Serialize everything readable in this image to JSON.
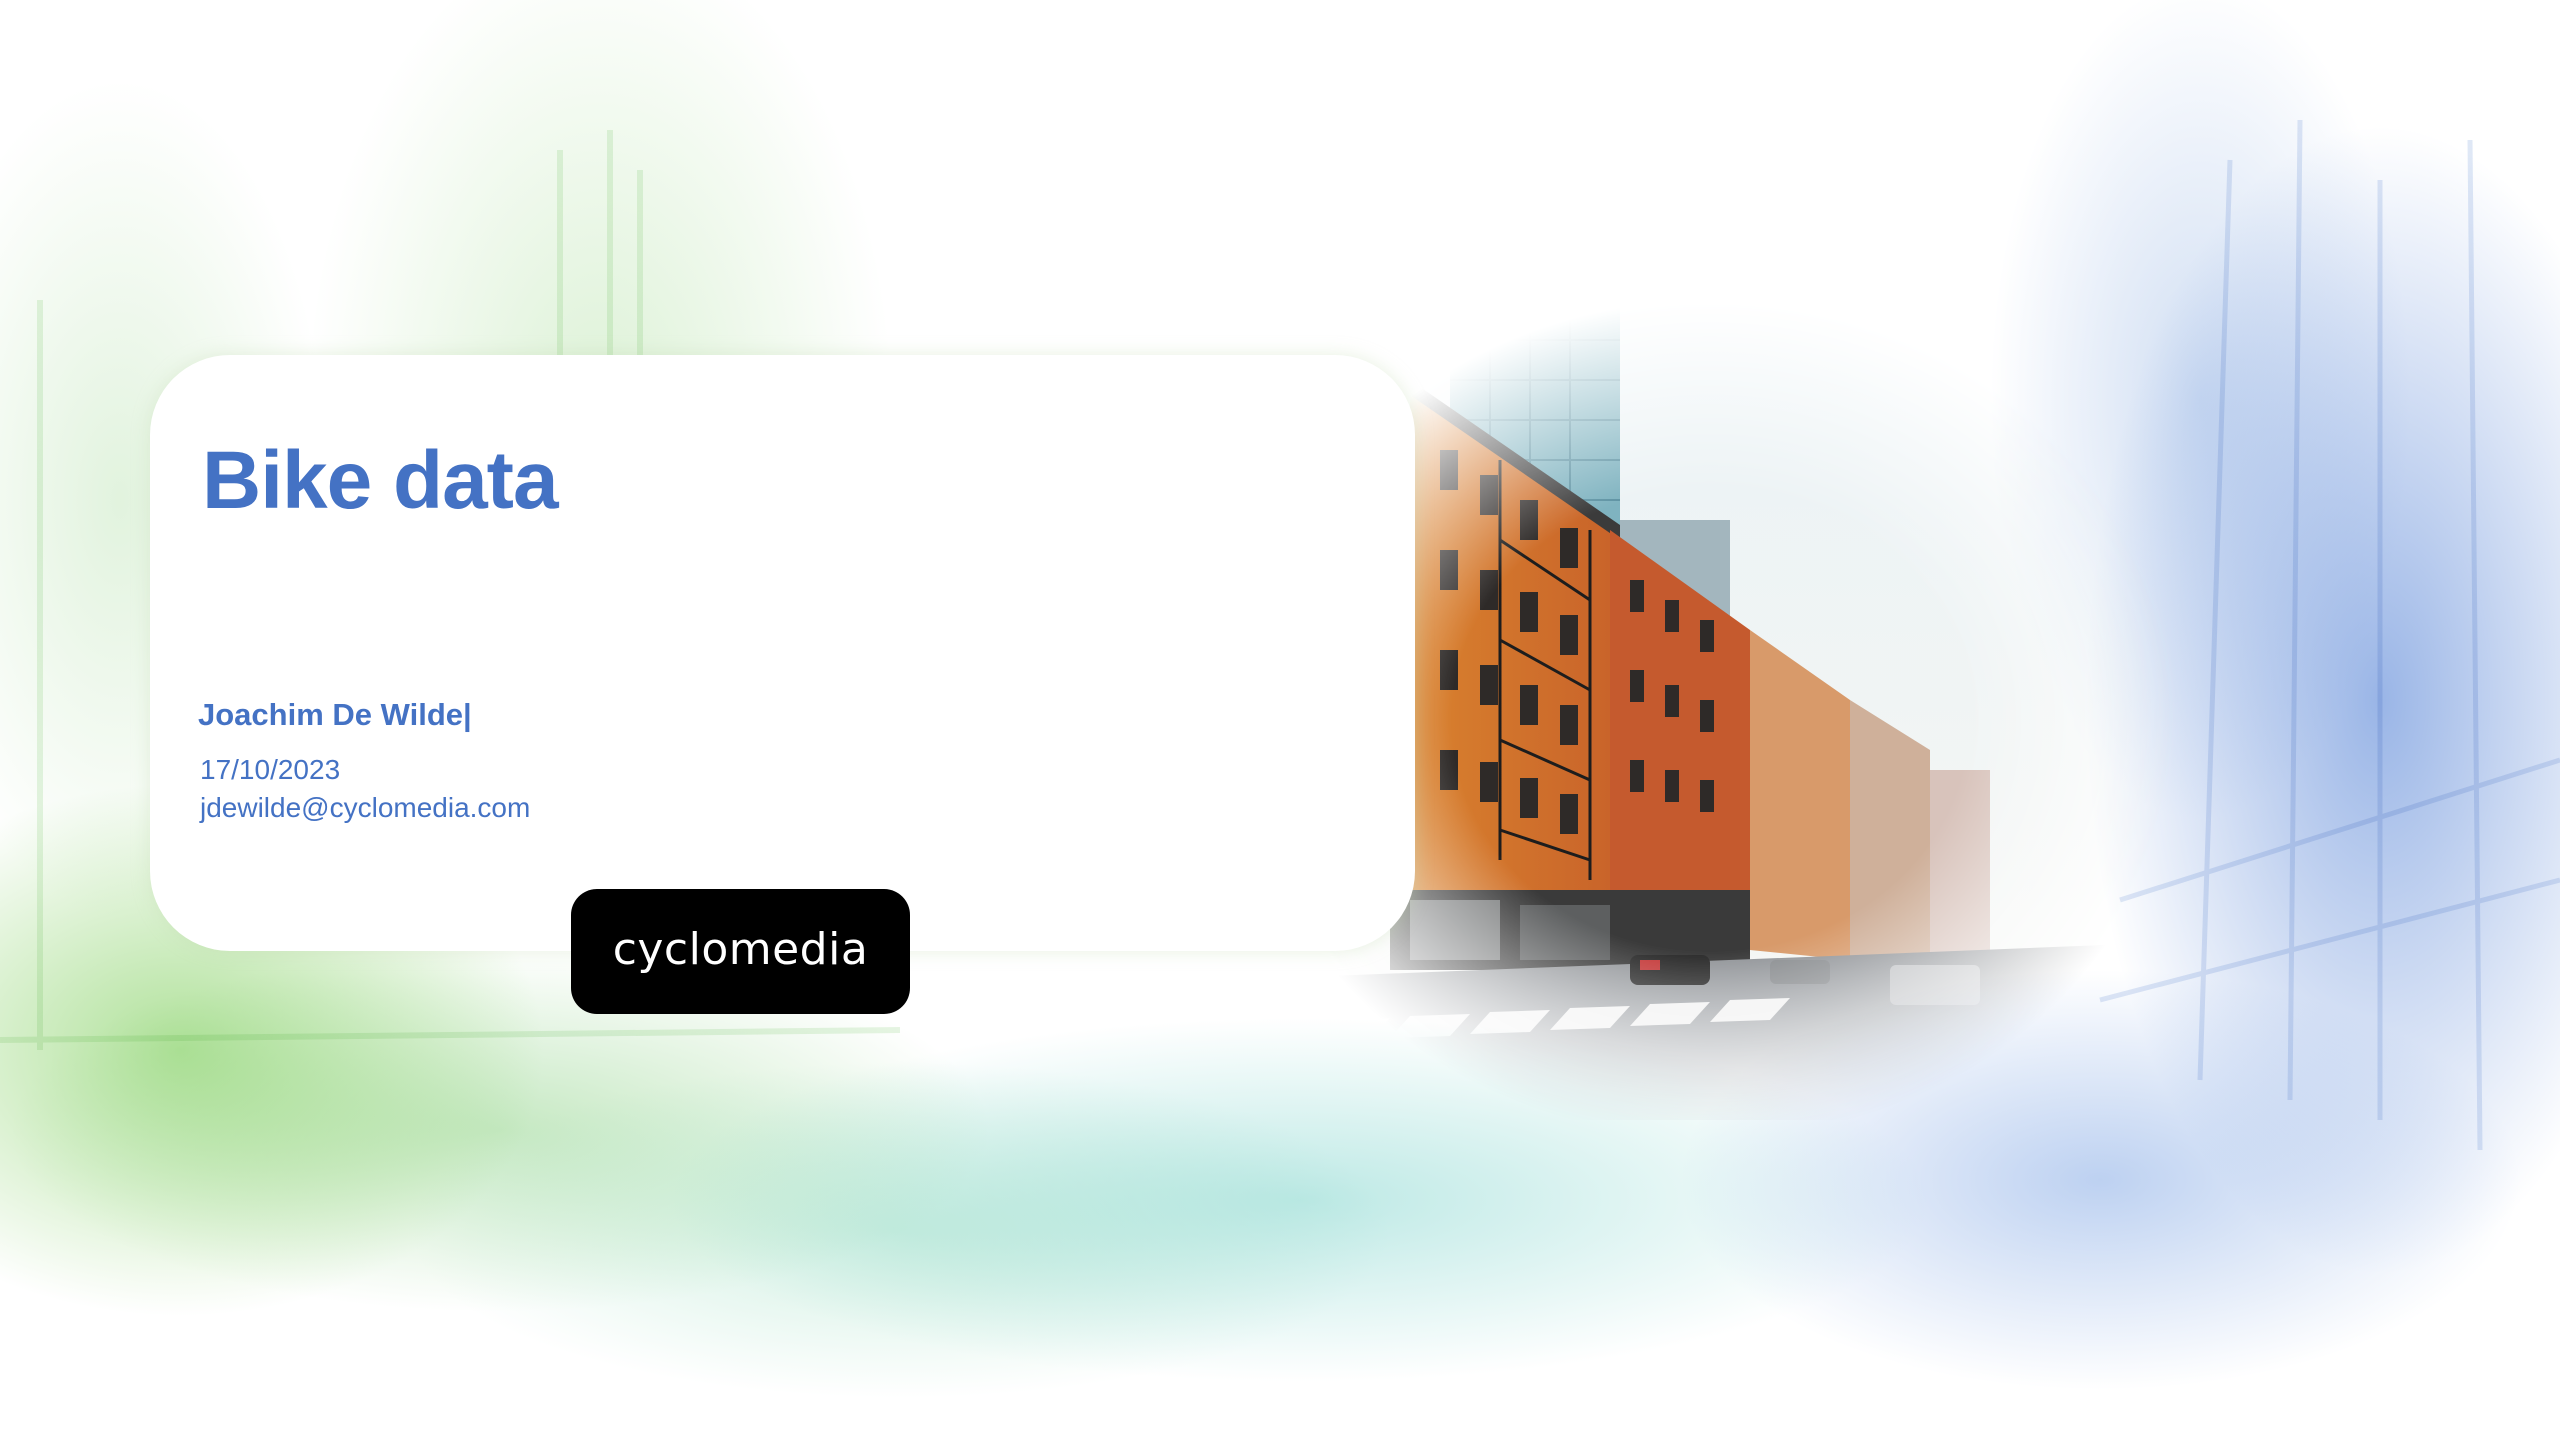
{
  "slide": {
    "title": "Bike data",
    "author": "Joachim De Wilde|",
    "date": "17/10/2023",
    "email": "jdewilde@cyclomedia.com",
    "logo_text": "cyclomedia"
  },
  "colors": {
    "accent": "#4472c4",
    "logo_background": "#000000",
    "card_background": "#ffffff"
  },
  "icons": [
    "cyclomedia-logo",
    "street-photograph",
    "point-cloud-background"
  ]
}
